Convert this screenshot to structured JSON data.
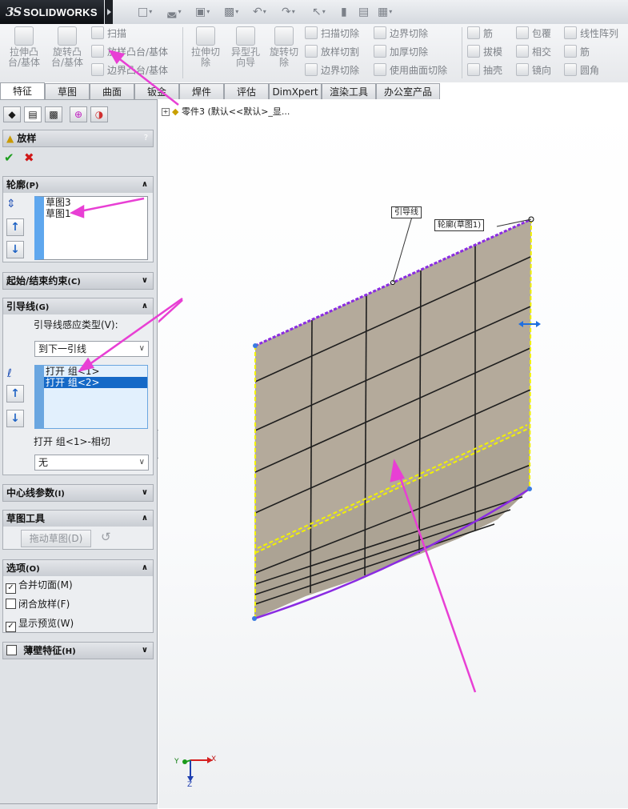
{
  "app": {
    "brand_prefix": "3S",
    "brand_name": "SOLIDWORKS"
  },
  "quick_access": {
    "icons": [
      "new-file-icon",
      "open-file-icon",
      "save-icon",
      "print-icon",
      "undo-icon",
      "redo-icon",
      "select-icon",
      "rebuild-icon",
      "file-properties-icon",
      "options-icon"
    ]
  },
  "command_manager": {
    "big_buttons": [
      {
        "label1": "拉伸凸",
        "label2": "台/基体"
      },
      {
        "label1": "旋转凸",
        "label2": "台/基体"
      },
      {
        "label1": "拉伸切",
        "label2": "除"
      },
      {
        "label1": "异型孔",
        "label2": "向导"
      },
      {
        "label1": "旋转切",
        "label2": "除"
      }
    ],
    "small_buttons": [
      "扫描",
      "放样凸台/基体",
      "边界凸台/基体",
      "扫描切除",
      "放样切割",
      "边界切除",
      "边界切除",
      "加厚切除",
      "使用曲面切除",
      "筋",
      "拔模",
      "抽壳",
      "包覆",
      "相交",
      "镜向",
      "线性阵列",
      "筋",
      "圆角"
    ]
  },
  "tabs": [
    "特征",
    "草图",
    "曲面",
    "钣金",
    "焊件",
    "评估",
    "DimXpert",
    "渲染工具",
    "办公室产品"
  ],
  "property_manager": {
    "title": "放样",
    "help": "?",
    "ok_symbol": "✔",
    "cancel_symbol": "✖",
    "profiles": {
      "header": "轮廓",
      "key": "(P)",
      "items": [
        "草图3",
        "草图1"
      ]
    },
    "start_end": {
      "header": "起始/结束约束",
      "key": "(C)"
    },
    "guides": {
      "header": "引导线",
      "key": "(G)",
      "influence_label": "引导线感应类型(V):",
      "influence_value": "到下一引线",
      "items": [
        "打开 组<1>",
        "打开 组<2>"
      ],
      "tangency_label": "打开 组<1>-相切",
      "tangency_value": "无"
    },
    "centerline": {
      "header": "中心线参数",
      "key": "(I)"
    },
    "sketch_tools": {
      "header": "草图工具",
      "drag_sketch": "拖动草图(D)"
    },
    "options": {
      "header": "选项",
      "key": "(O)",
      "merge": {
        "label": "合并切面(M)",
        "checked": true
      },
      "close": {
        "label": "闭合放样(F)",
        "checked": false
      },
      "preview": {
        "label": "显示预览(W)",
        "checked": true
      }
    },
    "thin": {
      "header": "薄壁特征",
      "key": "(H)",
      "checked": false
    }
  },
  "graphics": {
    "tree_text": "零件3  (默认<<默认>_显...",
    "callout_guide": "引导线",
    "callout_profile": "轮廓(草图1)",
    "triad": {
      "x": "X",
      "y": "Y",
      "z": "Z"
    }
  },
  "colors": {
    "annotation_arrow": "#e83fd4",
    "profile_edge": "#8a2be2",
    "surface": "#b4aa9b",
    "selection_yellow": "#f2f200",
    "list_select": "#1569c7"
  }
}
